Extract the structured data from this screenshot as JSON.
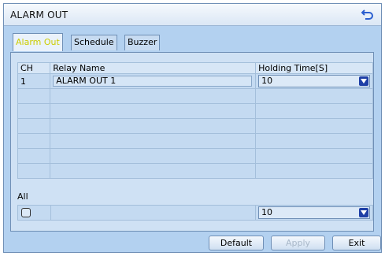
{
  "window": {
    "title": "ALARM OUT",
    "back_icon": "back-arrow-icon"
  },
  "tabs": [
    {
      "label": "Alarm Out",
      "active": true
    },
    {
      "label": "Schedule",
      "active": false
    },
    {
      "label": "Buzzer",
      "active": false
    }
  ],
  "table": {
    "headers": [
      "CH",
      "Relay Name",
      "Holding Time[S]"
    ],
    "rows": [
      {
        "ch": "1",
        "relay_name": "ALARM OUT 1",
        "holding_time": "10"
      }
    ],
    "empty_rows": 6
  },
  "all": {
    "label": "All",
    "checked": false,
    "holding_time": "10"
  },
  "buttons": {
    "default": "Default",
    "apply": "Apply",
    "exit": "Exit"
  },
  "colors": {
    "accent_active_tab": "#cccc00",
    "dropdown_button": "#1e3fa6",
    "window_bg": "#b3d1f0"
  }
}
